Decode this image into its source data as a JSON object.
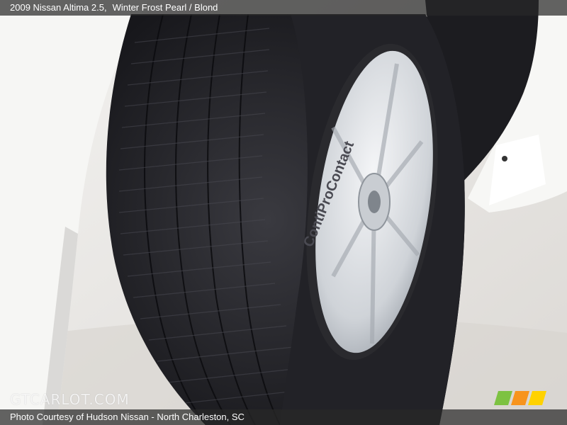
{
  "header": {
    "vehicle": "2009 Nissan Altima 2.5,",
    "color": "Winter Frost Pearl / Blond"
  },
  "tire": {
    "sidewall_text": "ContiProContact"
  },
  "watermark": {
    "text": "GTCARLOT.COM"
  },
  "footer": {
    "credit": "Photo Courtesy of Hudson Nissan - North Charleston, SC"
  },
  "badge": {
    "colors": [
      "#7dc242",
      "#f7941d",
      "#ffd200"
    ]
  }
}
